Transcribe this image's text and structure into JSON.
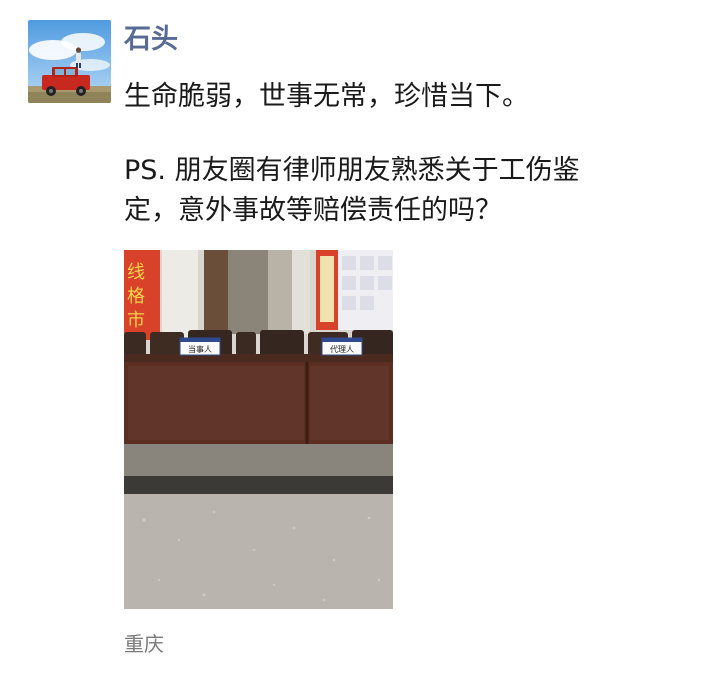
{
  "post": {
    "author": "石头",
    "lines": [
      "生命脆弱，世事无常，珍惜当下。",
      "PS. 朋友圈有律师朋友熟悉关于工伤鉴",
      "定，意外事故等赔偿责任的吗？"
    ],
    "photo": {
      "nameplates": [
        "当事人",
        "代理人"
      ]
    },
    "location": "重庆"
  },
  "colors": {
    "author": "#576b95",
    "text": "#1a1a1a",
    "location": "#7a7a7a"
  },
  "icons": {
    "avatar": "avatar-photo"
  }
}
